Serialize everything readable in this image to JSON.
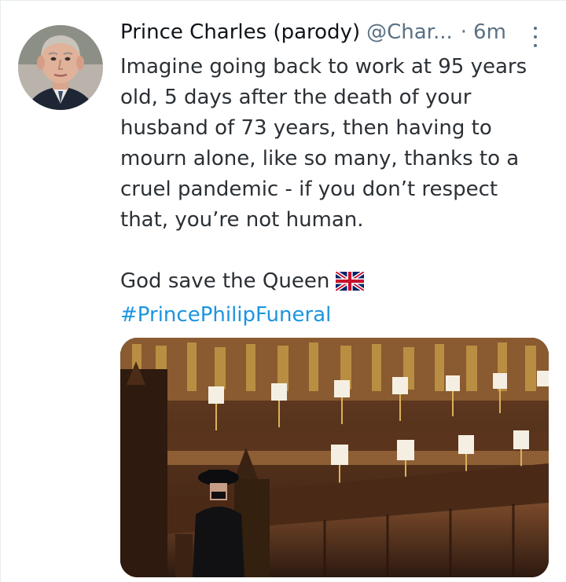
{
  "tweet": {
    "display_name": "Prince Charles (parody)",
    "handle": "@Char...",
    "separator": "·",
    "time": "6m",
    "text_lines": [
      "Imagine going back to work at 95 years",
      "old, 5 days after the death of your",
      "husband of 73 years, then having to",
      "mourn alone, like so many, thanks to a",
      "cruel pandemic - if you don’t respect",
      "that, you’re not human."
    ],
    "second_line": "God save the Queen",
    "hashtag": "#PrincePhilipFuneral"
  },
  "colors": {
    "link": "#1b95e0",
    "secondary_text": "#5b7083"
  },
  "icons": {
    "more": "more-options-icon",
    "flag": "uk-flag-icon"
  }
}
